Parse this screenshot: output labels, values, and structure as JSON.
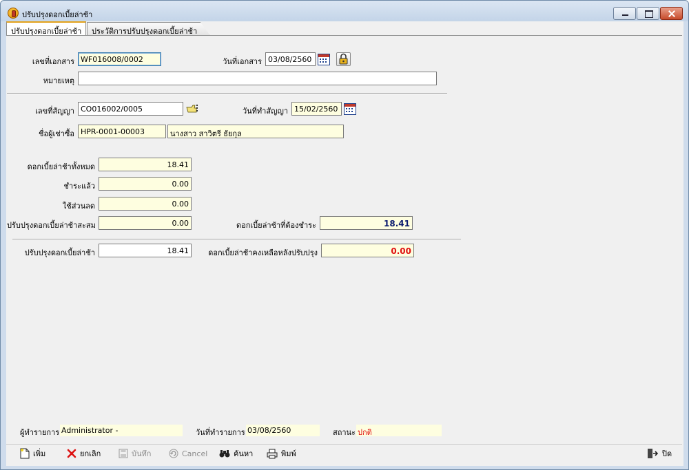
{
  "window": {
    "title": "ปรับปรุงดอกเบี้ยล่าช้า"
  },
  "tabs": [
    {
      "label": "ปรับปรุงดอกเบี้ยล่าช้า",
      "active": true
    },
    {
      "label": "ประวัติการปรับปรุงดอกเบี้ยล่าช้า",
      "active": false
    }
  ],
  "form": {
    "doc_no_label": "เลขที่เอกสาร",
    "doc_no_value": "WF016008/0002",
    "doc_date_label": "วันที่เอกสาร",
    "doc_date_value": "03/08/2560",
    "remark_label": "หมายเหตุ",
    "remark_value": "",
    "contract_no_label": "เลขที่สัญญา",
    "contract_no_value": "CO016002/0005",
    "contract_date_label": "วันที่ทำสัญญา",
    "contract_date_value": "15/02/2560",
    "buyer_label": "ชื่อผู้เช่าซื้อ",
    "buyer_code": "HPR-0001-00003",
    "buyer_name": "นางสาว สาวิตรี ธัยกุล",
    "total_interest_label": "ดอกเบี้ยล่าช้าทั้งหมด",
    "total_interest_value": "18.41",
    "paid_label": "ชำระแล้ว",
    "paid_value": "0.00",
    "discount_label": "ใช้ส่วนลด",
    "discount_value": "0.00",
    "accum_adjust_label": "ปรับปรุงดอกเบี้ยล่าช้าสะสม",
    "accum_adjust_value": "0.00",
    "due_interest_label": "ดอกเบี้ยล่าช้าที่ต้องชำระ",
    "due_interest_value": "18.41",
    "adjust_label": "ปรับปรุงดอกเบี้ยล่าช้า",
    "adjust_value": "18.41",
    "remaining_label": "ดอกเบี้ยล่าช้าคงเหลือหลังปรับปรุง",
    "remaining_value": "0.00"
  },
  "status": {
    "user_label": "ผู้ทำรายการ",
    "user_value": "Administrator -",
    "date_label": "วันที่ทำรายการ",
    "date_value": "03/08/2560",
    "state_label": "สถานะ",
    "state_value": "ปกติ"
  },
  "toolbar": {
    "add": "เพิ่ม",
    "cancel_doc": "ยกเลิก",
    "save": "บันทึก",
    "cancel": "Cancel",
    "search": "ค้นหา",
    "print": "พิมพ์",
    "close": "ปิด"
  },
  "colors": {
    "due_value": "#0b1b6e",
    "remaining_value": "#e01010",
    "readonly_bg": "#fefee0",
    "active_tab_accent": "#e3a21a"
  }
}
